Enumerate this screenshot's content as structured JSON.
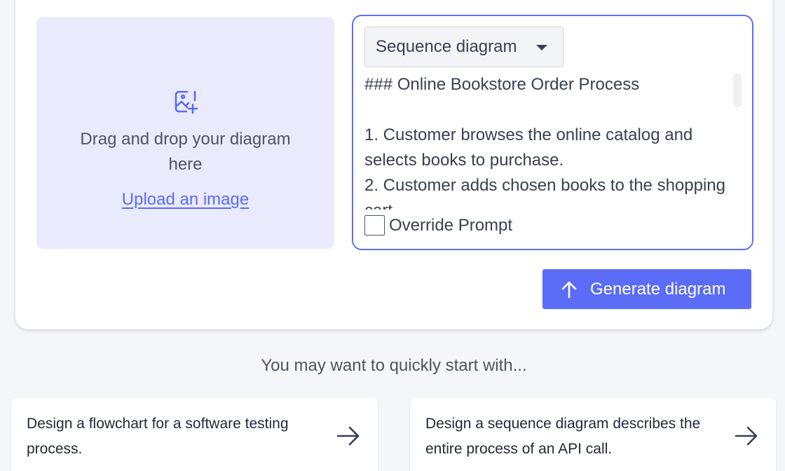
{
  "dropzone": {
    "icon": "image-add-icon",
    "text": "Drag and drop your diagram here",
    "upload_link": "Upload an image"
  },
  "prompt": {
    "diagram_type": "Sequence diagram",
    "text": "### Online Bookstore Order Process\n\n1. Customer browses the online catalog and selects books to purchase.\n2. Customer adds chosen books to the shopping cart.",
    "override_label": "Override Prompt",
    "override_checked": false
  },
  "generate_button": {
    "label": "Generate diagram",
    "icon": "arrow-up-icon"
  },
  "hint": "You may want to quickly start with...",
  "suggestions": [
    {
      "text": "Design a flowchart for a software testing process.",
      "icon": "arrow-right-icon"
    },
    {
      "text": "Design a sequence diagram describes the entire process of an API call.",
      "icon": "arrow-right-icon"
    }
  ],
  "colors": {
    "accent": "#5b6cf6",
    "dropzone_bg": "#e9eafc",
    "page_bg": "#f5f6f9"
  }
}
